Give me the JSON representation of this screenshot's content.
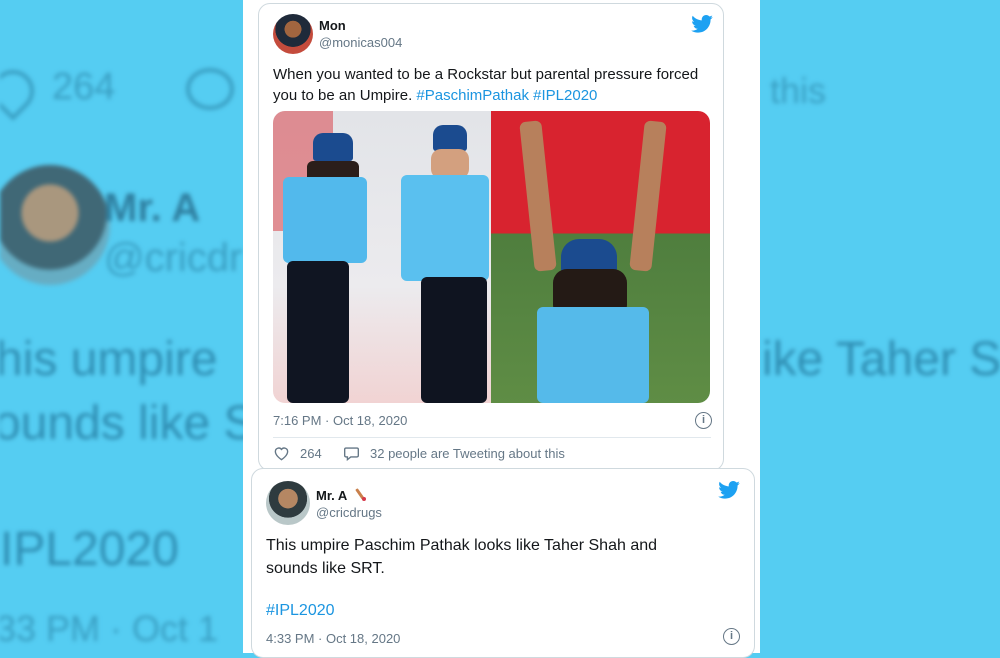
{
  "background": {
    "stat_count": "264",
    "this_text": "this",
    "name": "Mr. A",
    "handle": "@cricdr",
    "line1": "his umpire",
    "line1_right": "ike Taher S",
    "line2": "ounds like S",
    "hashtag": "IPL2020",
    "time": "33 PM · Oct 1"
  },
  "tweet1": {
    "name": "Mon",
    "handle": "@monicas004",
    "text_plain": "When you wanted to be a Rockstar but parental pressure forced you to be an Umpire.",
    "hashtag1": "#PaschimPathak",
    "hashtag2": "#IPL2020",
    "timestamp": "7:16 PM · Oct 18, 2020",
    "likes": "264",
    "tweeting": "32 people are Tweeting about this"
  },
  "tweet2": {
    "name": "Mr. A",
    "handle": "@cricdrugs",
    "text_line1": "This umpire Paschim Pathak looks like Taher Shah and",
    "text_line2": "sounds like SRT.",
    "hashtag": "#IPL2020",
    "timestamp": "4:33 PM · Oct 18, 2020"
  },
  "icons": {
    "brand": "twitter-bird-icon",
    "info": "info-icon",
    "like": "heart-icon",
    "reply": "speech-bubble-icon",
    "emoji": "cricket-bat-icon"
  },
  "colors": {
    "background": "#55cdf2",
    "accent": "#1b95e0",
    "text": "#14171a",
    "muted": "#657786"
  }
}
